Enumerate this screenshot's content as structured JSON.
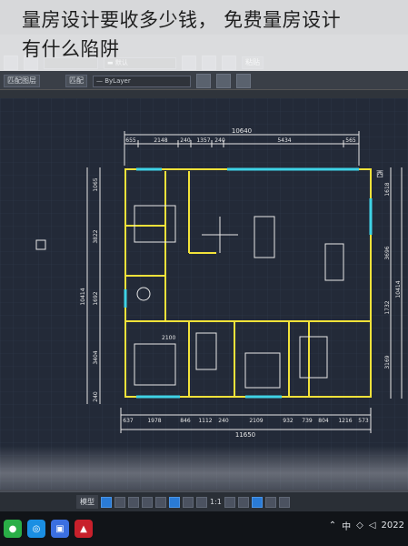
{
  "title_overlay": {
    "line1": "量房设计要收多少钱， 免费量房设计",
    "line2": "有什么陷阱"
  },
  "ribbon": {
    "match_layer_label": "匹配图层",
    "match_label": "匹配",
    "linetype_value": "ByLayer",
    "default_value": "默认",
    "paste_label": "粘贴"
  },
  "drawing": {
    "overall_width_top": "10640",
    "overall_width_bottom": "11650",
    "top_segments": [
      "655",
      "2148",
      "240",
      "1357",
      "240",
      "5434",
      "565"
    ],
    "bottom_segments": [
      "637",
      "1978",
      "846",
      "1112",
      "240",
      "2109",
      "932",
      "739",
      "804",
      "1216",
      "573"
    ],
    "left_overall": "10414",
    "left_segments": [
      "1065",
      "3822",
      "1692",
      "3404",
      "240"
    ],
    "right_overall": "10414",
    "right_segments": [
      "1618",
      "3696",
      "1732",
      "3169"
    ],
    "inner_label": "2100",
    "compass_label": "西"
  },
  "statusbar": {
    "model_tab": "模型",
    "scale": "1:1"
  },
  "taskbar": {
    "ime_label": "中",
    "clock": "2022"
  },
  "colors": {
    "accent_blue": "#2a7bd6",
    "wall_yellow": "#f2e23a",
    "dim_white": "#e8e8e8",
    "cyan": "#3fd3e6"
  }
}
